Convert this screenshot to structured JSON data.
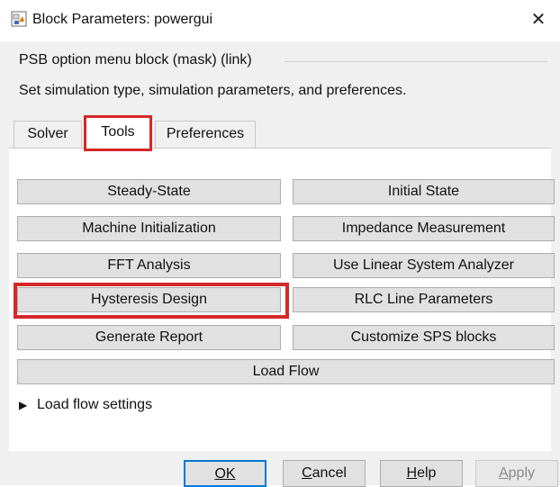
{
  "window": {
    "title": "Block Parameters: powergui",
    "close_glyph": "✕"
  },
  "header": {
    "group_title": "PSB option menu block (mask) (link)",
    "description": "Set simulation type, simulation parameters, and preferences."
  },
  "tabs": [
    {
      "label": "Solver",
      "selected": false
    },
    {
      "label": "Tools",
      "selected": true
    },
    {
      "label": "Preferences",
      "selected": false
    }
  ],
  "tools": {
    "steady_state": "Steady-State",
    "initial_state": "Initial State",
    "machine_init": "Machine Initialization",
    "impedance": "Impedance Measurement",
    "fft": "FFT Analysis",
    "linear_analyzer": "Use Linear System Analyzer",
    "hysteresis": "Hysteresis Design",
    "rlc": "RLC Line Parameters",
    "report": "Generate Report",
    "customize": "Customize SPS blocks",
    "load_flow": "Load Flow"
  },
  "load_flow_settings": {
    "label": "Load flow settings",
    "arrow": "▶"
  },
  "footer": {
    "ok": "OK",
    "cancel_first": "C",
    "cancel_rest": "ancel",
    "help_first": "H",
    "help_rest": "elp",
    "apply_first": "A",
    "apply_rest": "pply"
  },
  "colors": {
    "highlight": "#d62828",
    "default_focus": "#0078d7"
  }
}
